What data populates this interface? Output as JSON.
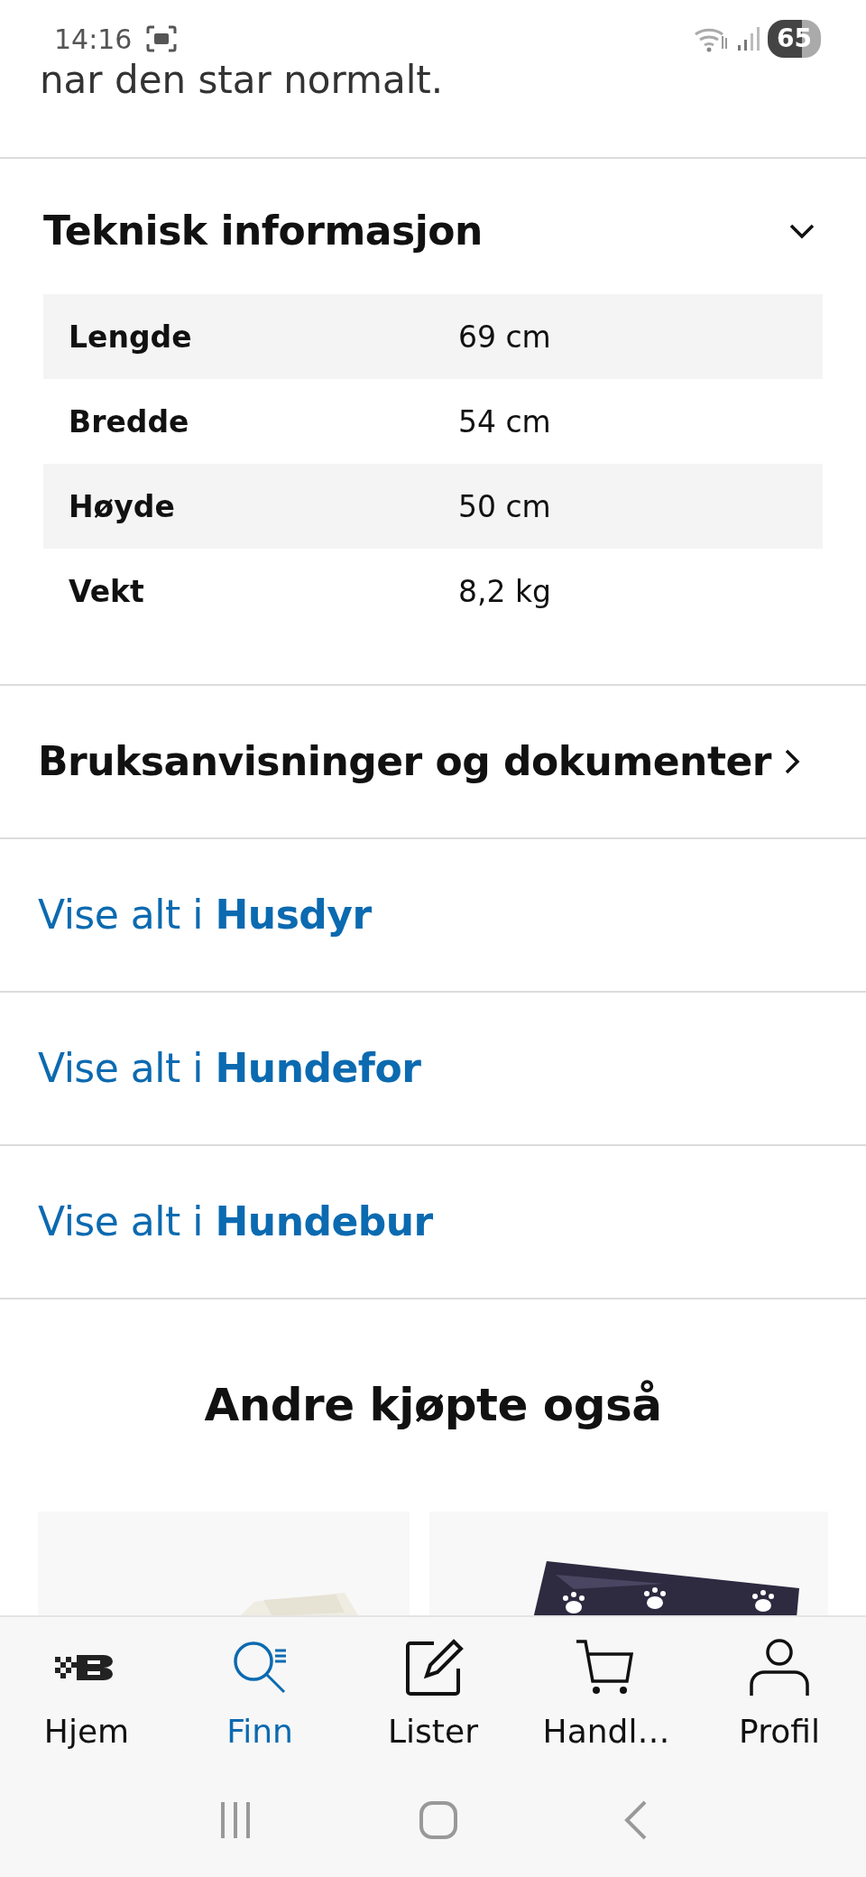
{
  "status_bar": {
    "time": "14:16",
    "battery": "65"
  },
  "intro_text": "nar den star normalt.",
  "tech_section": {
    "title": "Teknisk informasjon",
    "expanded": true,
    "rows": [
      {
        "label": "Lengde",
        "value": "69 cm"
      },
      {
        "label": "Bredde",
        "value": "54 cm"
      },
      {
        "label": "Høyde",
        "value": "50 cm"
      },
      {
        "label": "Vekt",
        "value": "8,2 kg"
      }
    ]
  },
  "documents_link": {
    "title": "Bruksanvisninger og dokumenter"
  },
  "category_links": [
    {
      "text": "Vise alt i **Husdyr**"
    },
    {
      "text": "Vise alt i **Hundefor**"
    },
    {
      "text": "Vise alt i **Hundebur**"
    }
  ],
  "recommendations": {
    "title": "Andre kjøpte også"
  },
  "bottom_nav": [
    {
      "kind": "home",
      "label": "Hjem",
      "selected": false
    },
    {
      "kind": "search",
      "label": "Finn",
      "selected": true
    },
    {
      "kind": "lists",
      "label": "Lister",
      "selected": false
    },
    {
      "kind": "cart",
      "label": "Handl…",
      "selected": false
    },
    {
      "kind": "profile",
      "label": "Profil",
      "selected": false
    }
  ]
}
